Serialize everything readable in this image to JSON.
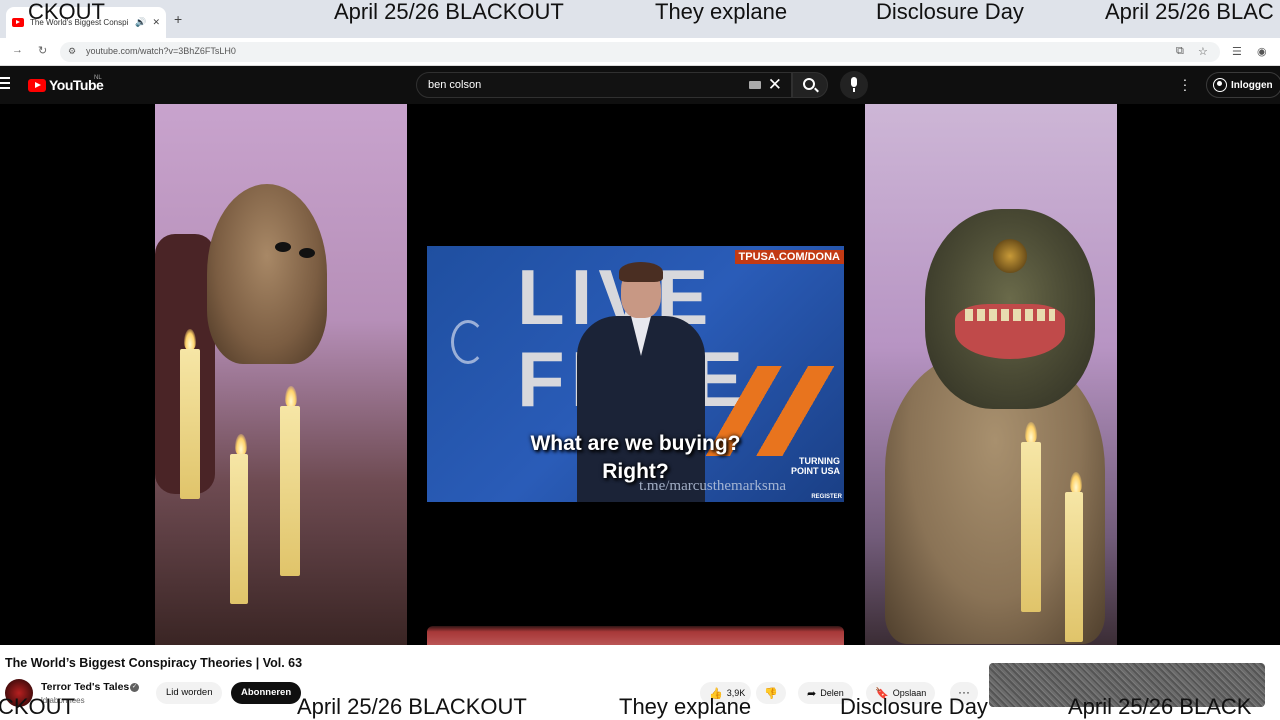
{
  "browser": {
    "tab_title": "The World's Biggest Conspi",
    "url": "youtube.com/watch?v=3BhZ6FTsLH0"
  },
  "ticker_top": [
    "CKOUT",
    "April 25/26 BLACKOUT",
    "They explane",
    "Disclosure Day",
    "April 25/26 BLAC"
  ],
  "ticker_bottom": [
    "CKOUT",
    "April 25/26 BLACKOUT",
    "They explane",
    "Disclosure Day",
    "April 25/26 BLACK"
  ],
  "youtube": {
    "logo_text": "YouTube",
    "country_code": "NL",
    "search_value": "ben colson",
    "signin_label": "Inloggen"
  },
  "video": {
    "clip_url_banner": "TPUSA.COM/DONA",
    "big_text": "LIVE\nFREE",
    "caption_line1": "What are we buying?",
    "caption_line2": "Right?",
    "watermark": "t.me/marcusthemarksma",
    "org_logo": "TURNING\nPOINT USA",
    "register": "REGISTER"
  },
  "info": {
    "title": "The World’s Biggest Conspiracy Theories | Vol. 63",
    "channel_name": "Terror Ted's Tales",
    "subs": "ld abonnees",
    "member_label": "Lid worden",
    "subscribe_label": "Abonneren",
    "likes": "3,9K",
    "share_label": "Delen",
    "save_label": "Opslaan"
  }
}
